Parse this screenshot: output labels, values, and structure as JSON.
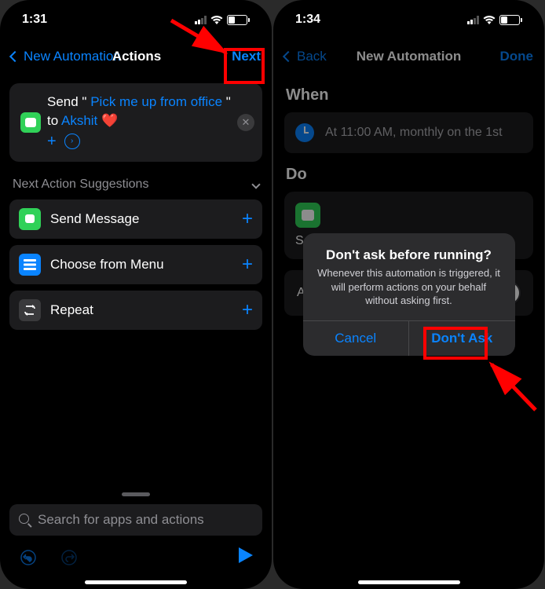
{
  "left": {
    "status": {
      "time": "1:31",
      "battery": "33"
    },
    "nav": {
      "back": "New Automation",
      "title": "Actions",
      "next": "Next"
    },
    "action": {
      "send_prefix": "Send \"",
      "message_text": "Pick me up from office",
      "send_suffix": "\" to",
      "recipient": "Akshit",
      "heart": "❤️",
      "plus": "+"
    },
    "suggestions": {
      "header": "Next Action Suggestions",
      "items": [
        {
          "label": "Send Message"
        },
        {
          "label": "Choose from Menu"
        },
        {
          "label": "Repeat"
        }
      ]
    },
    "search": {
      "placeholder": "Search for apps and actions"
    }
  },
  "right": {
    "status": {
      "time": "1:34",
      "battery": "32"
    },
    "nav": {
      "back": "Back",
      "title": "New Automation",
      "done": "Done"
    },
    "when": {
      "label": "When",
      "text": "At 11:00 AM, monthly on the 1st"
    },
    "do": {
      "label": "Do",
      "action_label": "Sen"
    },
    "ask": {
      "label": "Ask"
    },
    "modal": {
      "title": "Don't ask before running?",
      "message": "Whenever this automation is triggered, it will perform actions on your behalf without asking first.",
      "cancel": "Cancel",
      "confirm": "Don't Ask"
    }
  }
}
